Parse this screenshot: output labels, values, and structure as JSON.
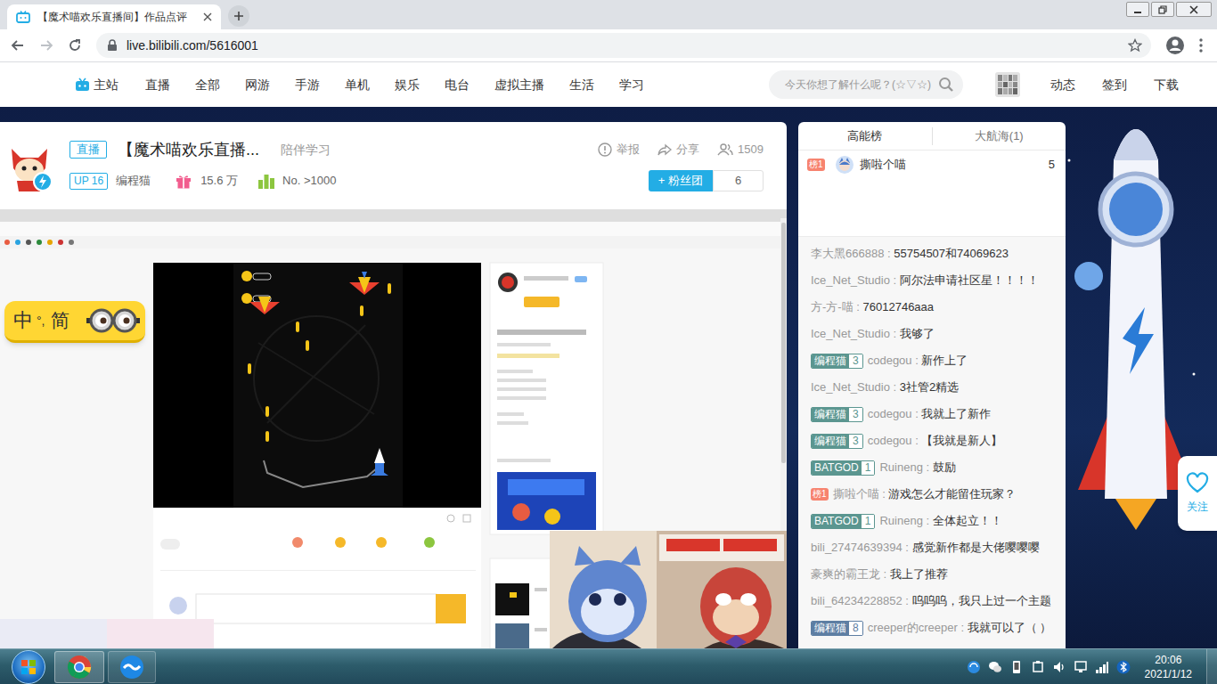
{
  "browser": {
    "tab_title": "【魔术喵欢乐直播间】作品点评",
    "address": "live.bilibili.com/5616001"
  },
  "nav": {
    "home": "主站",
    "items": [
      "直播",
      "全部",
      "网游",
      "手游",
      "单机",
      "娱乐",
      "电台",
      "虚拟主播",
      "生活",
      "学习"
    ],
    "search_placeholder": "今天你想了解什么呢？(☆▽☆)",
    "links": [
      "动态",
      "签到",
      "下载"
    ]
  },
  "room": {
    "live_tag": "直播",
    "title": "【魔术喵欢乐直播...",
    "area": "陪伴学习",
    "up_level": "UP 16",
    "uploader": "编程猫",
    "gifts": "15.6 万",
    "rank": "No. >1000",
    "report": "举报",
    "share": "分享",
    "viewers": "1509",
    "fan_button": "+ 粉丝团",
    "fans": "6"
  },
  "translator": [
    "中",
    "°,",
    "简"
  ],
  "ranking": {
    "tabs": [
      {
        "label": "高能榜",
        "selected": true
      },
      {
        "label": "大航海(1)",
        "selected": false
      }
    ],
    "entries": [
      {
        "badge": "榜1",
        "name": "撕啦个喵",
        "score": "5"
      }
    ]
  },
  "chat": {
    "separator": " : ",
    "messages": [
      {
        "kind": "plain",
        "user": "李大黑666888",
        "text": "55754507和74069623"
      },
      {
        "kind": "plain",
        "user": "Ice_Net_Studio",
        "text": "阿尔法申请社区星！！！！"
      },
      {
        "kind": "plain",
        "user": "方-方-喵",
        "text": "76012746aaa"
      },
      {
        "kind": "plain",
        "user": "Ice_Net_Studio",
        "text": "我够了"
      },
      {
        "kind": "medal",
        "medal": "编程猫",
        "level": "3",
        "color": "#5b9690",
        "user": "codegou",
        "text": "新作上了"
      },
      {
        "kind": "plain",
        "user": "Ice_Net_Studio",
        "text": "3社管2精选"
      },
      {
        "kind": "medal",
        "medal": "编程猫",
        "level": "3",
        "color": "#5b9690",
        "user": "codegou",
        "text": "我就上了新作"
      },
      {
        "kind": "medal",
        "medal": "编程猫",
        "level": "3",
        "color": "#5b9690",
        "user": "codegou",
        "text": "【我就是新人】"
      },
      {
        "kind": "medal",
        "medal": "BATGOD",
        "level": "1",
        "color": "#5b9690",
        "user": "Ruineng",
        "text": "鼓励"
      },
      {
        "kind": "rank",
        "badge": "榜1",
        "user": "撕啦个喵",
        "text": "游戏怎么才能留住玩家？"
      },
      {
        "kind": "medal",
        "medal": "BATGOD",
        "level": "1",
        "color": "#5b9690",
        "user": "Ruineng",
        "text": "全体起立！！"
      },
      {
        "kind": "plain",
        "user": "bili_27474639394",
        "text": "感觉新作都是大佬嘤嘤嘤"
      },
      {
        "kind": "plain",
        "user": "豪爽的霸王龙",
        "text": "我上了推荐"
      },
      {
        "kind": "plain",
        "user": "bili_64234228852",
        "text": "呜呜呜，我只上过一个主题"
      },
      {
        "kind": "medal",
        "medal": "编程猫",
        "level": "8",
        "color": "#5d7ea3",
        "user": "creeper的creeper",
        "text": "我就可以了（ ）"
      }
    ]
  },
  "follow": "关注",
  "clock": {
    "time": "20:06",
    "date": "2021/1/12"
  }
}
